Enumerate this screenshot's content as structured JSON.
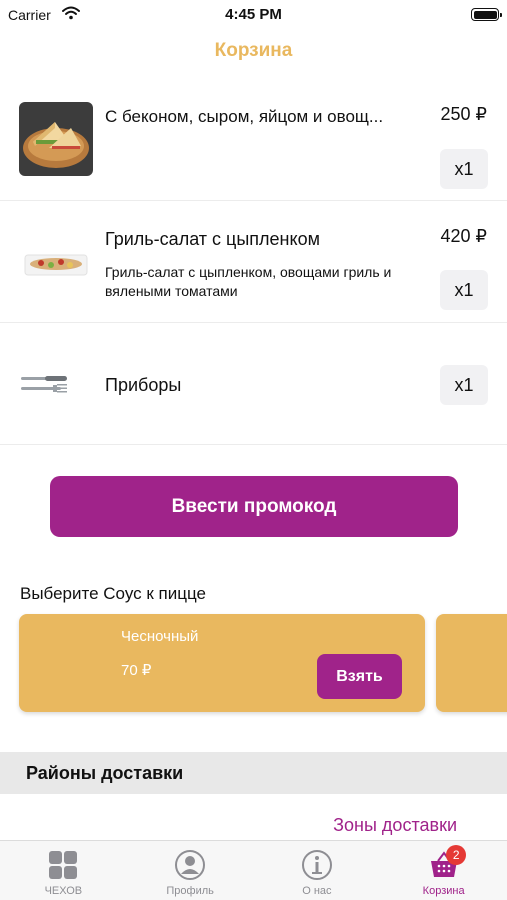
{
  "status_bar": {
    "carrier": "Carrier",
    "time": "4:45 PM"
  },
  "header": {
    "title": "Корзина"
  },
  "cart": {
    "items": [
      {
        "name": "С беконом, сыром, яйцом и овощ...",
        "description": "",
        "price": "250 ₽",
        "quantity": "x1",
        "thumbnail_icon": "sandwich-image"
      },
      {
        "name": "Гриль-салат с цыпленком",
        "description": "Гриль-салат с цыпленком, овощами гриль и вялеными томатами",
        "price": "420 ₽",
        "quantity": "x1",
        "thumbnail_icon": "grill-salad-image"
      },
      {
        "name": "Приборы",
        "description": "",
        "price": "",
        "quantity": "x1",
        "thumbnail_icon": "cutlery-image"
      }
    ]
  },
  "promo": {
    "button_label": "Ввести промокод"
  },
  "sauces": {
    "title": "Выберите Соус к пицце",
    "items": [
      {
        "name": "Чесночный",
        "price": "70 ₽",
        "button_label": "Взять"
      }
    ]
  },
  "delivery": {
    "header": "Районы доставки",
    "zones_link": "Зоны доставки"
  },
  "tab_bar": {
    "tabs": [
      {
        "label": "ЧЕХОВ",
        "icon": "grid-icon",
        "active": false
      },
      {
        "label": "Профиль",
        "icon": "profile-icon",
        "active": false
      },
      {
        "label": "О нас",
        "icon": "info-icon",
        "active": false
      },
      {
        "label": "Корзина",
        "icon": "basket-icon",
        "active": true,
        "badge": "2"
      }
    ]
  },
  "colors": {
    "accent": "#a0238a",
    "title": "#e9b85f",
    "sauce_card": "#e9b85f",
    "badge": "#e53935"
  }
}
